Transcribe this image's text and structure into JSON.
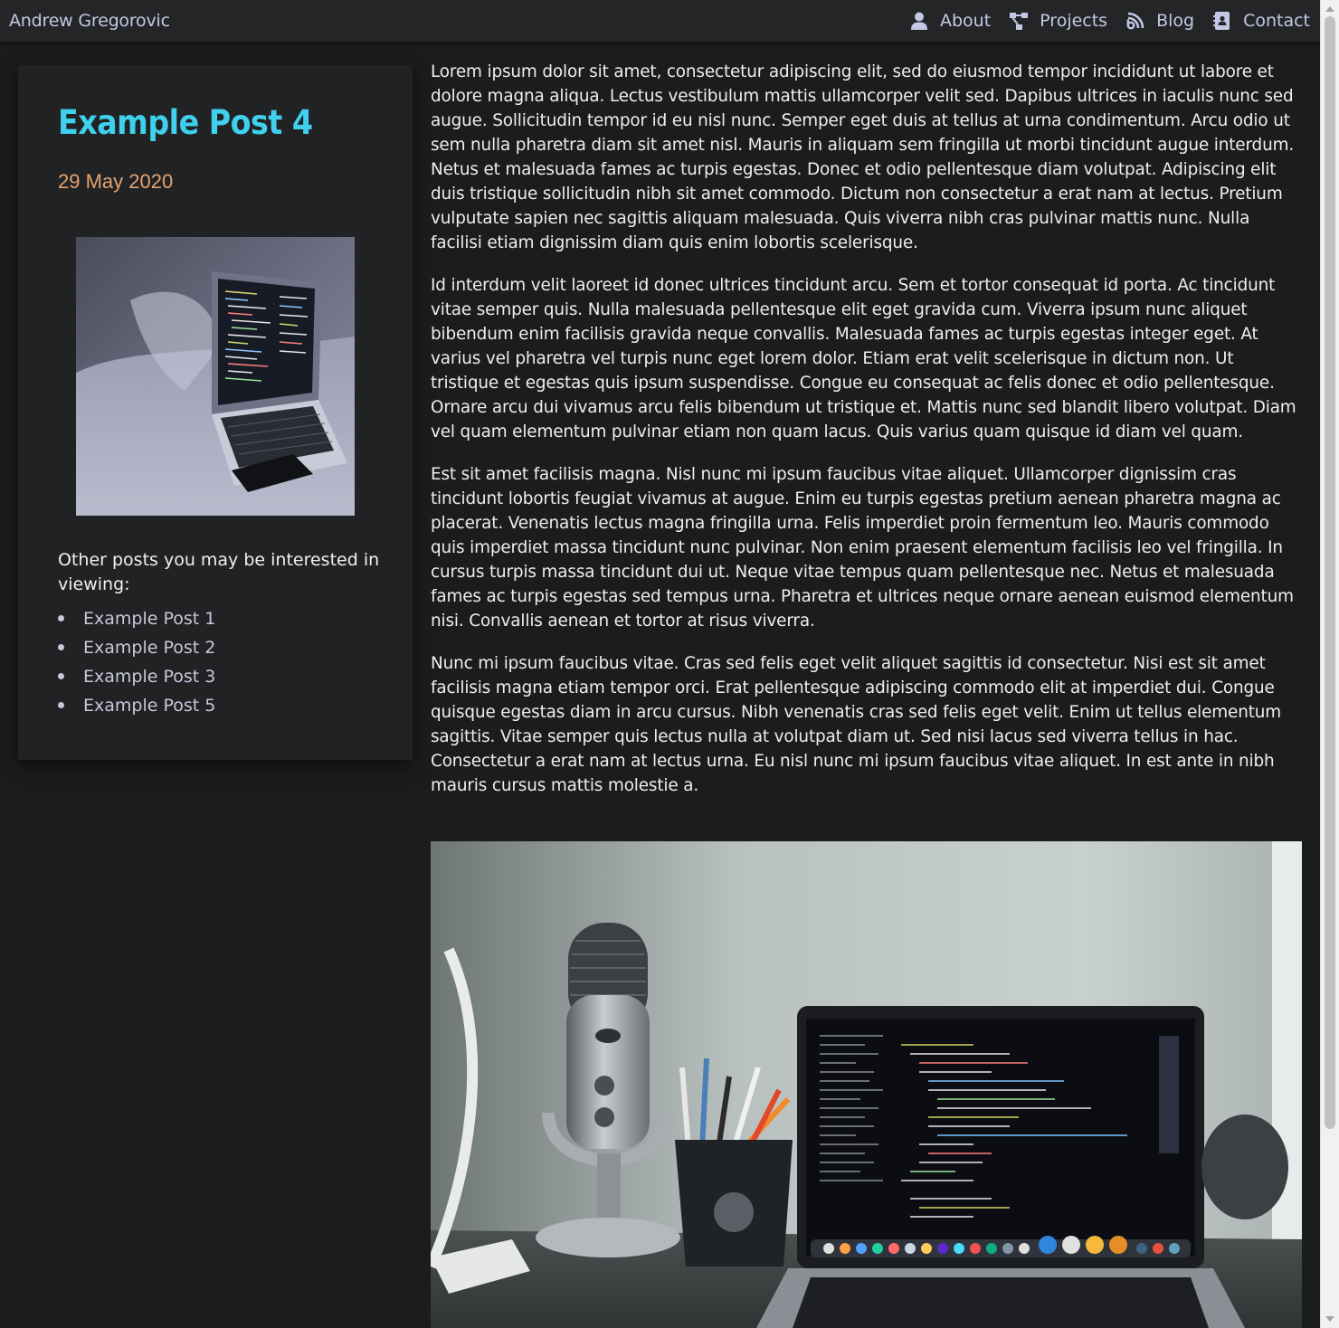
{
  "nav": {
    "brand": "Andrew Gregorovic",
    "items": [
      {
        "label": "About",
        "icon": "user-icon"
      },
      {
        "label": "Projects",
        "icon": "project-diagram-icon"
      },
      {
        "label": "Blog",
        "icon": "blog-icon"
      },
      {
        "label": "Contact",
        "icon": "address-book-icon"
      }
    ]
  },
  "post": {
    "title": "Example Post 4",
    "date": "29 May 2020",
    "thumbnail": "laptop-on-couch-photo"
  },
  "related": {
    "heading": "Other posts you may be interested in viewing:",
    "items": [
      "Example Post 1",
      "Example Post 2",
      "Example Post 3",
      "Example Post 5"
    ]
  },
  "article": {
    "paragraphs": [
      "Lorem ipsum dolor sit amet, consectetur adipiscing elit, sed do eiusmod tempor incididunt ut labore et dolore magna aliqua. Lectus vestibulum mattis ullamcorper velit sed. Dapibus ultrices in iaculis nunc sed augue. Sollicitudin tempor id eu nisl nunc. Semper eget duis at tellus at urna condimentum. Arcu odio ut sem nulla pharetra diam sit amet nisl. Mauris in aliquam sem fringilla ut morbi tincidunt augue interdum. Netus et malesuada fames ac turpis egestas. Donec et odio pellentesque diam volutpat. Adipiscing elit duis tristique sollicitudin nibh sit amet commodo. Dictum non consectetur a erat nam at lectus. Pretium vulputate sapien nec sagittis aliquam malesuada. Quis viverra nibh cras pulvinar mattis nunc. Nulla facilisi etiam dignissim diam quis enim lobortis scelerisque.",
      "Id interdum velit laoreet id donec ultrices tincidunt arcu. Sem et tortor consequat id porta. Ac tincidunt vitae semper quis. Nulla malesuada pellentesque elit eget gravida cum. Viverra ipsum nunc aliquet bibendum enim facilisis gravida neque convallis. Malesuada fames ac turpis egestas integer eget. At varius vel pharetra vel turpis nunc eget lorem dolor. Etiam erat velit scelerisque in dictum non. Ut tristique et egestas quis ipsum suspendisse. Congue eu consequat ac felis donec et odio pellentesque. Ornare arcu dui vivamus arcu felis bibendum ut tristique et. Mattis nunc sed blandit libero volutpat. Diam vel quam elementum pulvinar etiam non quam lacus. Quis varius quam quisque id diam vel quam.",
      "Est sit amet facilisis magna. Nisl nunc mi ipsum faucibus vitae aliquet. Ullamcorper dignissim cras tincidunt lobortis feugiat vivamus at augue. Enim eu turpis egestas pretium aenean pharetra magna ac placerat. Venenatis lectus magna fringilla urna. Felis imperdiet proin fermentum leo. Mauris commodo quis imperdiet massa tincidunt nunc pulvinar. Non enim praesent elementum facilisis leo vel fringilla. In cursus turpis massa tincidunt dui ut. Neque vitae tempus quam pellentesque nec. Netus et malesuada fames ac turpis egestas sed tempus urna. Pharetra et ultrices neque ornare aenean euismod elementum nisi. Convallis aenean et tortor at risus viverra.",
      "Nunc mi ipsum faucibus vitae. Cras sed felis eget velit aliquet sagittis id consectetur. Nisi est sit amet facilisis magna etiam tempor orci. Erat pellentesque adipiscing commodo elit at imperdiet dui. Congue quisque egestas diam in arcu cursus. Nibh venenatis cras sed felis eget velit. Enim ut tellus elementum sagittis. Vitae semper quis lectus nulla at volutpat diam ut. Sed nisi lacus sed viverra tellus in hac. Consectetur a erat nam at lectus urna. Eu nisl nunc mi ipsum faucibus vitae aliquet. In est ante in nibh mauris cursus mattis molestie a."
    ],
    "image": "desk-microphone-laptop-photo"
  },
  "colors": {
    "background": "#1b1c1e",
    "navbar": "#242527",
    "card": "#212224",
    "title": "#3fd0ee",
    "date": "#e3a370",
    "link": "#c7c8da",
    "nav_text": "#c5c7e6"
  }
}
